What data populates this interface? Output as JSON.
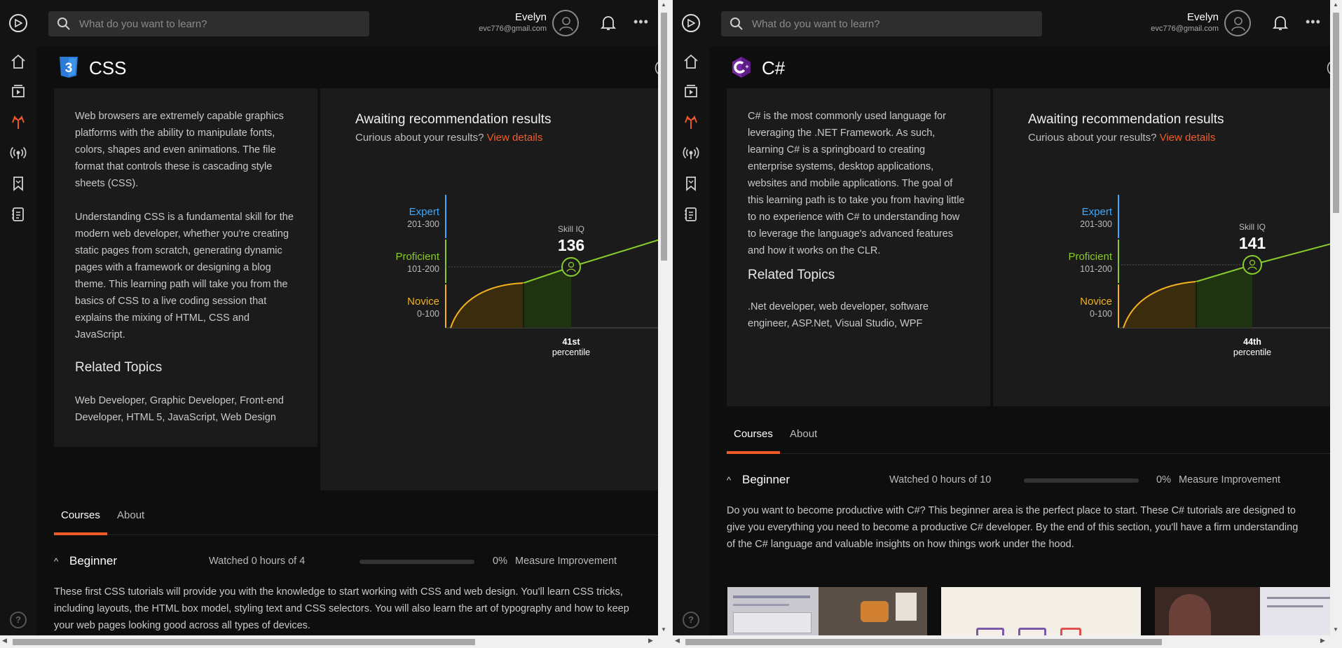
{
  "colors": {
    "accent": "#f15b2a",
    "expert": "#3ea8ff",
    "proficient": "#88cc2a",
    "novice": "#f5b21a"
  },
  "panes": [
    {
      "search_placeholder": "What do you want to learn?",
      "user": {
        "name": "Evelyn",
        "email": "evc776@gmail.com"
      },
      "topic": {
        "title": "CSS",
        "badge_icon": "css3-icon"
      },
      "description": [
        "Web browsers are extremely capable graphics platforms with the ability to manipulate fonts, colors, shapes and even animations. The file format that controls these is cascading style sheets (CSS).",
        "Understanding CSS is a fundamental skill for the modern web developer, whether you're creating static pages from scratch, generating dynamic pages with a framework or designing a blog theme. This learning path will take you from the basics of CSS to a live coding session that explains the mixing of HTML, CSS and JavaScript."
      ],
      "related_heading": "Related Topics",
      "related_topics": "Web Developer, Graphic Developer, Front-end Developer, HTML 5, JavaScript, Web Design",
      "recommendation": {
        "title": "Awaiting recommendation results",
        "subtitle": "Curious about your results?",
        "link": "View details",
        "skill_label": "Skill IQ",
        "skill_value": "136",
        "percentile_value": "41st",
        "percentile_label": "percentile",
        "levels": [
          {
            "name": "Expert",
            "range": "201-300"
          },
          {
            "name": "Proficient",
            "range": "101-200"
          },
          {
            "name": "Novice",
            "range": "0-100"
          }
        ]
      },
      "tabs": [
        "Courses",
        "About"
      ],
      "level": {
        "name": "Beginner",
        "watched": "Watched 0 hours of 4",
        "progress": 0,
        "percent": "0%",
        "measure": "Measure Improvement",
        "description": "These first CSS tutorials will provide you with the knowledge to start working with CSS and web design. You'll learn CSS tricks, including layouts, the HTML box model, styling text and CSS selectors. You will also learn the art of typography and how to keep your web pages looking good across all types of devices."
      }
    },
    {
      "search_placeholder": "What do you want to learn?",
      "user": {
        "name": "Evelyn",
        "email": "evc776@gmail.com"
      },
      "topic": {
        "title": "C#",
        "badge_icon": "csharp-icon"
      },
      "description": [
        "C# is the most commonly used language for leveraging the .NET Framework. As such, learning C# is a springboard to creating enterprise systems, desktop applications, websites and mobile applications. The goal of this learning path is to take you from having little to no experience with C# to understanding how to leverage the language's advanced features and how it works on the CLR."
      ],
      "related_heading": "Related Topics",
      "related_topics": ".Net developer, web developer, software engineer, ASP.Net, Visual Studio, WPF",
      "recommendation": {
        "title": "Awaiting recommendation results",
        "subtitle": "Curious about your results?",
        "link": "View details",
        "skill_label": "Skill IQ",
        "skill_value": "141",
        "percentile_value": "44th",
        "percentile_label": "percentile",
        "levels": [
          {
            "name": "Expert",
            "range": "201-300"
          },
          {
            "name": "Proficient",
            "range": "101-200"
          },
          {
            "name": "Novice",
            "range": "0-100"
          }
        ]
      },
      "tabs": [
        "Courses",
        "About"
      ],
      "level": {
        "name": "Beginner",
        "watched": "Watched 0 hours of 10",
        "progress": 0,
        "percent": "0%",
        "measure": "Measure Improvement",
        "description": "Do you want to become productive with C#? This beginner area is the perfect place to start. These C# tutorials are designed to give you everything you need to become a productive C# developer. By the end of this section, you'll have a firm understanding of the C# language and valuable insights on how things work under the hood."
      }
    }
  ]
}
